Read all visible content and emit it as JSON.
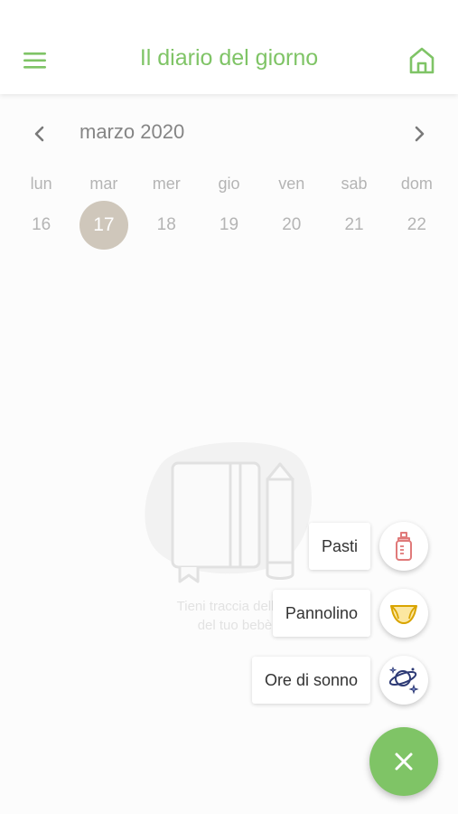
{
  "header": {
    "title": "Il diario del giorno",
    "menu_icon": "menu-icon",
    "home_icon": "home-icon",
    "accent": "#7fc466"
  },
  "calendar": {
    "month": "marzo 2020",
    "prev_icon": "chevron-left-icon",
    "next_icon": "chevron-right-icon",
    "days": [
      {
        "name": "lun",
        "num": "16"
      },
      {
        "name": "mar",
        "num": "17",
        "selected": true
      },
      {
        "name": "mer",
        "num": "18"
      },
      {
        "name": "gio",
        "num": "19"
      },
      {
        "name": "ven",
        "num": "20"
      },
      {
        "name": "sab",
        "num": "21"
      },
      {
        "name": "dom",
        "num": "22"
      }
    ],
    "selected_color": "#b5a997"
  },
  "empty_state": {
    "line1": "Tieni traccia della g",
    "line2": "del tuo bebè",
    "icon": "diary-pencil-illustration"
  },
  "actions": [
    {
      "label": "Pasti",
      "icon": "baby-bottle-icon"
    },
    {
      "label": "Pannolino",
      "icon": "diaper-icon"
    },
    {
      "label": "Ore di sonno",
      "icon": "sleep-planet-icon"
    }
  ],
  "fab": {
    "icon": "close-icon"
  }
}
